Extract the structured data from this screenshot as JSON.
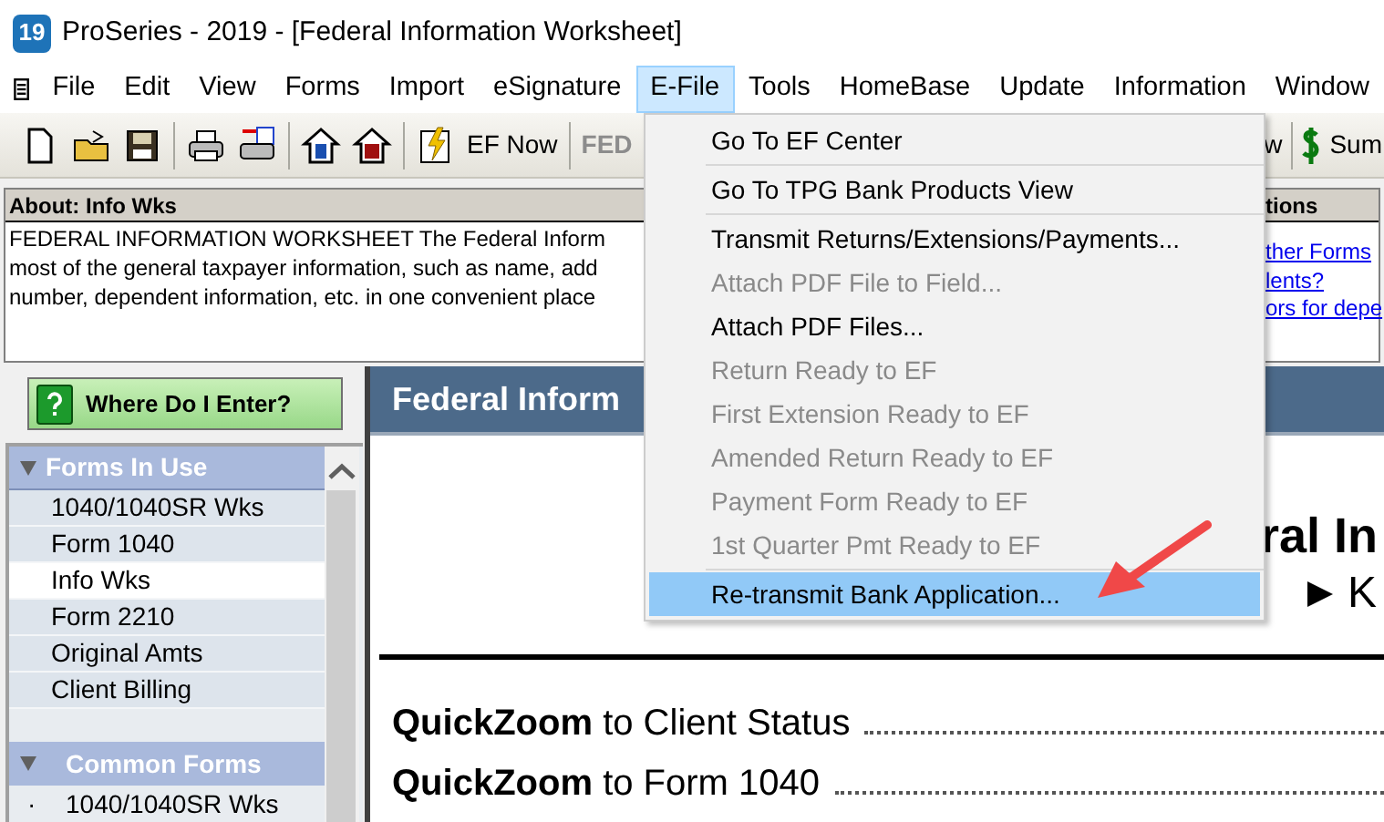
{
  "title_bar": {
    "app_badge": "19",
    "title": "ProSeries - 2019 - [Federal Information Worksheet]"
  },
  "menu_bar": {
    "items": [
      {
        "label": "File",
        "selected": false
      },
      {
        "label": "Edit",
        "selected": false
      },
      {
        "label": "View",
        "selected": false
      },
      {
        "label": "Forms",
        "selected": false
      },
      {
        "label": "Import",
        "selected": false
      },
      {
        "label": "eSignature",
        "selected": false
      },
      {
        "label": "E-File",
        "selected": true
      },
      {
        "label": "Tools",
        "selected": false
      },
      {
        "label": "HomeBase",
        "selected": false
      },
      {
        "label": "Update",
        "selected": false
      },
      {
        "label": "Information",
        "selected": false
      },
      {
        "label": "Window",
        "selected": false
      }
    ]
  },
  "toolbar": {
    "left_buttons": [
      {
        "label": "EF Now",
        "disabled": false
      },
      {
        "label": "FED",
        "disabled": true
      }
    ],
    "right_buttons": [
      {
        "label": "w"
      },
      {
        "label": "Sum"
      }
    ]
  },
  "about_panel": {
    "title": "About: Info Wks",
    "lines": [
      "FEDERAL INFORMATION WORKSHEET The Federal Inform",
      "most of the general taxpayer information, such as name, add",
      "number, dependent information, etc. in one convenient place"
    ],
    "right_title": "tions",
    "links": [
      "ther Forms",
      "lents?",
      "ors for depe"
    ]
  },
  "where_do_i_enter": {
    "label": "Where Do I Enter?"
  },
  "forms_in_use": {
    "title": "Forms In Use",
    "items": [
      {
        "label": "1040/1040SR Wks",
        "selected": false
      },
      {
        "label": "Form 1040",
        "selected": false
      },
      {
        "label": "Info Wks",
        "selected": true
      },
      {
        "label": "Form 2210",
        "selected": false
      },
      {
        "label": "Original Amts",
        "selected": false
      },
      {
        "label": "Client Billing",
        "selected": false
      }
    ]
  },
  "common_forms": {
    "title": "Common Forms",
    "items": [
      {
        "marker": "·",
        "label": "1040/1040SR Wks"
      }
    ]
  },
  "form": {
    "header": "Federal Inform",
    "heading": "ral In",
    "subheading": "K",
    "quickzoom": [
      {
        "text": "**QuickZoom** to Client Status"
      },
      {
        "text": "**QuickZoom** to Form 1040"
      }
    ]
  },
  "efile_menu": {
    "items": [
      {
        "kind": "item",
        "label": "Go To EF Center",
        "disabled": false,
        "selected": false
      },
      {
        "kind": "separator"
      },
      {
        "kind": "item",
        "label": "Go To TPG Bank Products View",
        "disabled": false,
        "selected": false
      },
      {
        "kind": "separator"
      },
      {
        "kind": "item",
        "label": "Transmit Returns/Extensions/Payments...",
        "disabled": false,
        "selected": false
      },
      {
        "kind": "item",
        "label": "Attach PDF File to Field...",
        "disabled": true,
        "selected": false
      },
      {
        "kind": "item",
        "label": "Attach PDF Files...",
        "disabled": false,
        "selected": false
      },
      {
        "kind": "item",
        "label": "Return Ready to EF",
        "disabled": true,
        "selected": false
      },
      {
        "kind": "item",
        "label": "First Extension Ready to EF",
        "disabled": true,
        "selected": false
      },
      {
        "kind": "item",
        "label": "Amended Return Ready to EF",
        "disabled": true,
        "selected": false
      },
      {
        "kind": "item",
        "label": "Payment Form Ready to EF",
        "disabled": true,
        "selected": false
      },
      {
        "kind": "item",
        "label": "1st Quarter Pmt Ready to EF",
        "disabled": true,
        "selected": false
      },
      {
        "kind": "separator"
      },
      {
        "kind": "item",
        "label": "Re-transmit Bank Application...",
        "disabled": false,
        "selected": true
      }
    ]
  }
}
